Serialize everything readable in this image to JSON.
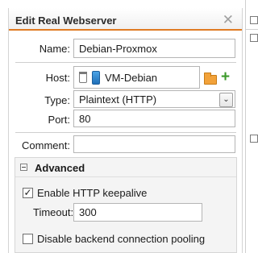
{
  "dialog": {
    "title": "Edit Real Webserver",
    "close_glyph": "✕"
  },
  "form": {
    "name_label": "Name:",
    "name_value": "Debian-Proxmox",
    "host_label": "Host:",
    "host_value": "VM-Debian",
    "type_label": "Type:",
    "type_value": "Plaintext (HTTP)",
    "port_label": "Port:",
    "port_value": "80",
    "comment_label": "Comment:",
    "comment_value": ""
  },
  "advanced": {
    "title": "Advanced",
    "keepalive_label": "Enable HTTP keepalive",
    "keepalive_checked": true,
    "timeout_label": "Timeout:",
    "timeout_value": "300",
    "pooling_label": "Disable backend connection pooling",
    "pooling_checked": false
  },
  "icons": {
    "close": "close-icon",
    "trash": "trash-icon",
    "host": "monitor-icon",
    "folder": "folder-icon",
    "add": "plus-icon",
    "dropdown": "chevron-down-icon",
    "collapse": "collapse-icon"
  },
  "colors": {
    "accent": "#e07b22",
    "add_green": "#3c9a2a",
    "folder_orange": "#f2a23a",
    "host_blue": "#1f6fb8"
  }
}
